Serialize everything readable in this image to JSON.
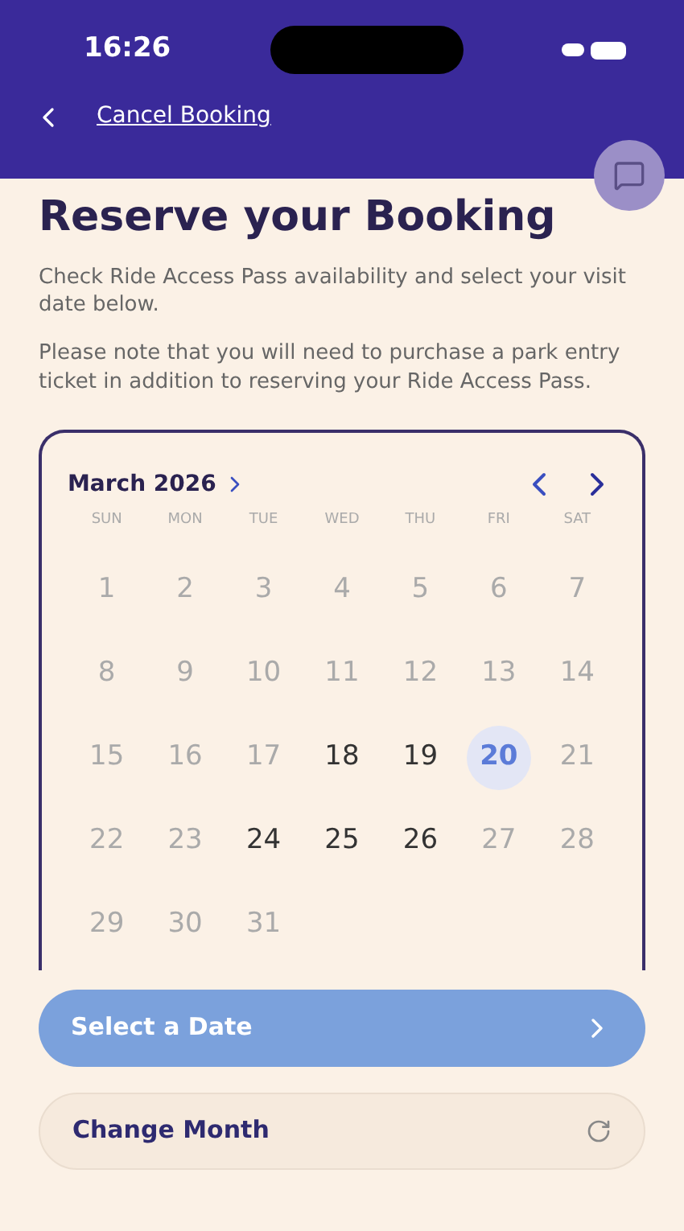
{
  "status_bar": {
    "time": "16:26"
  },
  "nav": {
    "back_label": "Cancel Booking"
  },
  "title": "Reserve your Booking",
  "paragraphs": [
    "Check Ride Access Pass availability and select your visit date below.",
    "Please note that you will need to purchase a park entry ticket in addition to reserving your Ride Access Pass."
  ],
  "calendar": {
    "month": "March 2026",
    "weekdays": [
      "SUN",
      "MON",
      "TUE",
      "WED",
      "THU",
      "FRI",
      "SAT"
    ],
    "days": [
      {
        "label": "1",
        "available": false,
        "selected": false
      },
      {
        "label": "2",
        "available": false,
        "selected": false
      },
      {
        "label": "3",
        "available": false,
        "selected": false
      },
      {
        "label": "4",
        "available": false,
        "selected": false
      },
      {
        "label": "5",
        "available": false,
        "selected": false
      },
      {
        "label": "6",
        "available": false,
        "selected": false
      },
      {
        "label": "7",
        "available": false,
        "selected": false
      },
      {
        "label": "8",
        "available": false,
        "selected": false
      },
      {
        "label": "9",
        "available": false,
        "selected": false
      },
      {
        "label": "10",
        "available": false,
        "selected": false
      },
      {
        "label": "11",
        "available": false,
        "selected": false
      },
      {
        "label": "12",
        "available": false,
        "selected": false
      },
      {
        "label": "13",
        "available": false,
        "selected": false
      },
      {
        "label": "14",
        "available": false,
        "selected": false
      },
      {
        "label": "15",
        "available": false,
        "selected": false
      },
      {
        "label": "16",
        "available": false,
        "selected": false
      },
      {
        "label": "17",
        "available": false,
        "selected": false
      },
      {
        "label": "18",
        "available": true,
        "selected": false
      },
      {
        "label": "19",
        "available": true,
        "selected": false
      },
      {
        "label": "20",
        "available": true,
        "selected": true
      },
      {
        "label": "21",
        "available": false,
        "selected": false
      },
      {
        "label": "22",
        "available": false,
        "selected": false
      },
      {
        "label": "23",
        "available": false,
        "selected": false
      },
      {
        "label": "24",
        "available": true,
        "selected": false
      },
      {
        "label": "25",
        "available": true,
        "selected": false
      },
      {
        "label": "26",
        "available": true,
        "selected": false
      },
      {
        "label": "27",
        "available": false,
        "selected": false
      },
      {
        "label": "28",
        "available": false,
        "selected": false
      },
      {
        "label": "29",
        "available": false,
        "selected": false
      },
      {
        "label": "30",
        "available": false,
        "selected": false
      },
      {
        "label": "31",
        "available": false,
        "selected": false
      }
    ]
  },
  "primary_button": {
    "label": "Select a Date",
    "disabled": true
  },
  "secondary_button": {
    "label": "Change Month"
  }
}
